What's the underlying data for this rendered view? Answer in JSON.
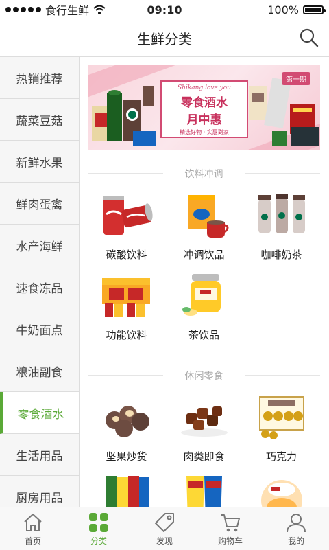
{
  "status_bar": {
    "carrier": "食行生鲜",
    "time": "09:10",
    "battery": "100%"
  },
  "header": {
    "title": "生鲜分类"
  },
  "sidebar": {
    "items": [
      {
        "label": "热销推荐",
        "active": false
      },
      {
        "label": "蔬菜豆菇",
        "active": false
      },
      {
        "label": "新鲜水果",
        "active": false
      },
      {
        "label": "鲜肉蛋禽",
        "active": false
      },
      {
        "label": "水产海鲜",
        "active": false
      },
      {
        "label": "速食冻品",
        "active": false
      },
      {
        "label": "牛奶面点",
        "active": false
      },
      {
        "label": "粮油副食",
        "active": false
      },
      {
        "label": "零食酒水",
        "active": true
      },
      {
        "label": "生活用品",
        "active": false
      },
      {
        "label": "厨房用品",
        "active": false
      }
    ]
  },
  "banner": {
    "issue": "第一期",
    "script": "Shikang love you",
    "title_line1": "零食酒水",
    "title_line2": "月中惠",
    "subtitle": "精选好物 · 实惠到家"
  },
  "sections": [
    {
      "title": "饮料冲调",
      "products": [
        {
          "label": "碳酸饮料",
          "icon": "cola-can-icon"
        },
        {
          "label": "冲调饮品",
          "icon": "instant-drink-icon"
        },
        {
          "label": "咖啡奶茶",
          "icon": "coffee-bottles-icon"
        },
        {
          "label": "功能饮料",
          "icon": "energy-drink-icon"
        },
        {
          "label": "茶饮品",
          "icon": "honey-tea-jar-icon"
        }
      ]
    },
    {
      "title": "休闲零食",
      "products": [
        {
          "label": "坚果炒货",
          "icon": "nuts-icon"
        },
        {
          "label": "肉类即食",
          "icon": "jerky-icon"
        },
        {
          "label": "巧克力",
          "icon": "chocolate-box-icon"
        },
        {
          "label": "",
          "icon": "snack-packs-icon"
        },
        {
          "label": "",
          "icon": "chips-bags-icon"
        },
        {
          "label": "",
          "icon": "cake-cup-icon"
        }
      ]
    }
  ],
  "tabbar": {
    "items": [
      {
        "label": "首页",
        "icon": "home-icon",
        "active": false
      },
      {
        "label": "分类",
        "icon": "category-icon",
        "active": true
      },
      {
        "label": "发现",
        "icon": "tag-icon",
        "active": false
      },
      {
        "label": "购物车",
        "icon": "cart-icon",
        "active": false
      },
      {
        "label": "我的",
        "icon": "user-icon",
        "active": false
      }
    ]
  },
  "colors": {
    "accent": "#5aa937",
    "text": "#222222",
    "muted": "#aaaaaa",
    "divider": "#dddddd"
  }
}
